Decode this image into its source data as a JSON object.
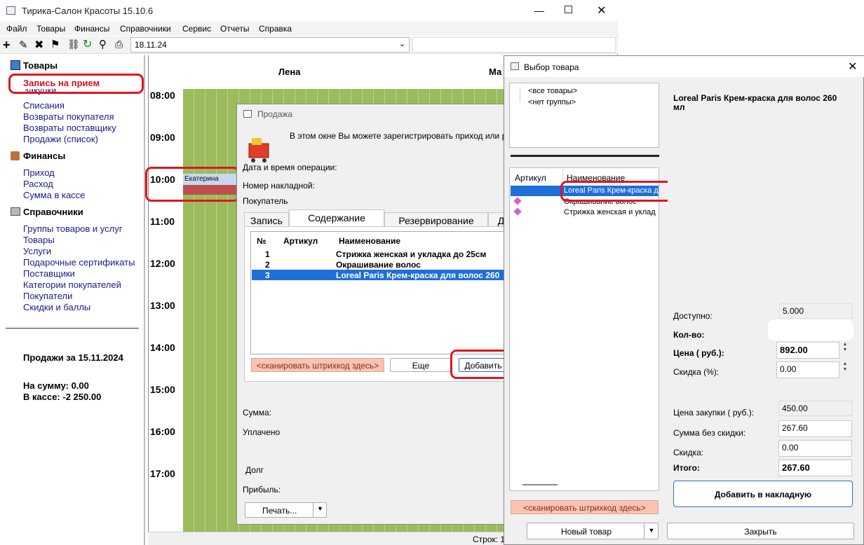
{
  "main_window": {
    "title": "Тирика-Салон Красоты 15.10.6",
    "menu": [
      "Файл",
      "Товары",
      "Финансы",
      "Справочники",
      "Сервис",
      "Отчеты",
      "Справка"
    ],
    "date_value": "18.11.24"
  },
  "sidebar": {
    "goods_title": "Товары",
    "goods_items": [
      "Запись на прием",
      "Закупки",
      "Списания",
      "Возвраты покупателя",
      "Возвраты поставщику",
      "Продажи (список)"
    ],
    "finance_title": "Финансы",
    "finance_items": [
      "Приход",
      "Расход",
      "Сумма в кассе"
    ],
    "refs_title": "Справочники",
    "refs_items": [
      "Группы товаров и услуг",
      "Товары",
      "Услуги",
      "Подарочные сертификаты",
      "Поставщики",
      "Категории покупателей",
      "Покупатели",
      "Скидки и баллы"
    ],
    "sales_title": "Продажи за 15.11.2024",
    "sales_sum": "На сумму: 0.00",
    "cash": "В кассе: -2 250.00"
  },
  "schedule": {
    "col1": "Лена",
    "col2": "Ма",
    "hours": [
      "08:00",
      "09:00",
      "10:00",
      "11:00",
      "12:00",
      "13:00",
      "14:00",
      "15:00",
      "16:00",
      "17:00"
    ],
    "appointment": "Екатерина"
  },
  "sale_dialog": {
    "title": "Продажа",
    "info": "В этом окне Вы можете зарегистрировать приход или расхо",
    "datetime_label": "Дата и время операции:",
    "invoice_label": "Номер накладной:",
    "buyer_label": "Покупатель",
    "tabs": [
      "Запись",
      "Содержание",
      "Резервирование",
      "Д"
    ],
    "table_headers": [
      "№",
      "Артикул",
      "Наименование"
    ],
    "rows": [
      {
        "n": "1",
        "name": "Стрижка женская и укладка до 25см"
      },
      {
        "n": "2",
        "name": "Окрашивание волос"
      },
      {
        "n": "3",
        "name": "Loreal Paris Крем-краска для волос 260"
      }
    ],
    "scan": "<сканировать штрихкод здесь>",
    "more": "Еще",
    "add": "Добавить",
    "sum_label": "Сумма:",
    "paid_label": "Уплачено",
    "debt_label": "Долг",
    "profit_label": "Прибыль:",
    "print": "Печать..."
  },
  "product_dialog": {
    "title": "Выбор товара",
    "tree": [
      "<все товары>",
      "<нет группы>"
    ],
    "headers": [
      "Артикул",
      "Наименование"
    ],
    "items": [
      "Loreal Paris Крем-краска дл",
      "Окрашивание волос",
      "Стрижка женская и уклад"
    ],
    "scan": "<сканировать штрихкод здесь>",
    "new_product": "Новый товар",
    "close": "Закрыть",
    "product_name": "Loreal Paris Крем-краска для волос 260 мл",
    "available_label": "Доступно:",
    "available": "5.000",
    "qty_label": "Кол-во:",
    "price_label": "Цена ( руб.):",
    "price": "892.00",
    "discount_pct_label": "Скидка (%):",
    "discount_pct": "0.00",
    "purchase_label": "Цена закупки ( руб.):",
    "purchase": "450.00",
    "sum_no_disc_label": "Сумма без скидки:",
    "sum_no_disc": "267.60",
    "discount_label": "Скидка:",
    "discount": "0.00",
    "total_label": "Итого:",
    "total": "267.60",
    "add_button": "Добавить в накладную"
  },
  "status": {
    "rows": "Строк: 1"
  }
}
